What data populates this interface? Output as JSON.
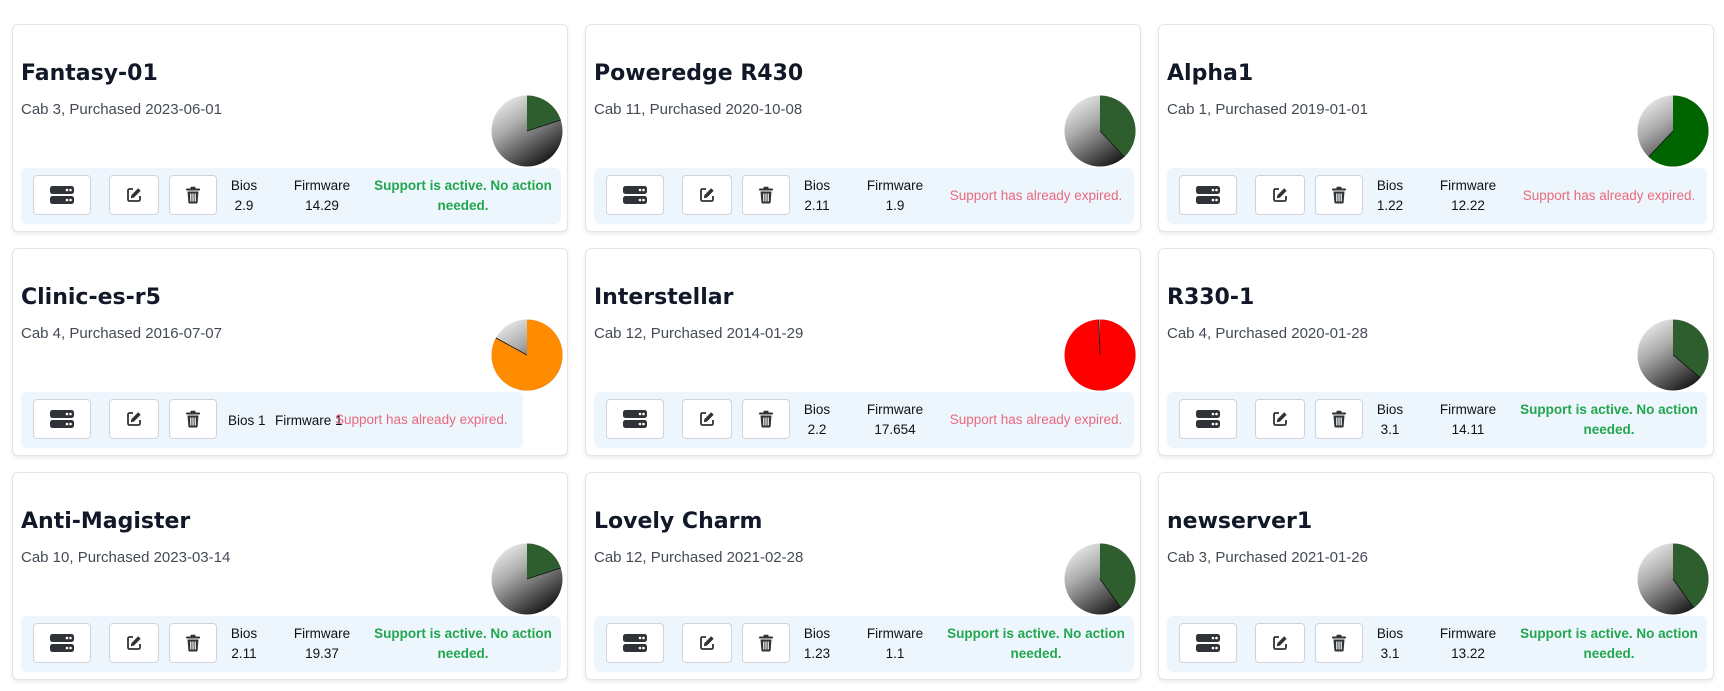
{
  "colors": {
    "active_text": "#22a64e",
    "expired_text": "#e8697d",
    "panel_bg": "#eef6fd",
    "pie_dark_green": "#2e5e2e",
    "pie_green": "#006400",
    "pie_orange": "#ff8c00",
    "pie_red": "#ff0000"
  },
  "icons": {
    "server": "server-icon",
    "edit": "edit-icon",
    "delete": "trash-icon"
  },
  "servers": [
    {
      "name": "Fantasy-01",
      "subtitle": "Cab 3, Purchased 2023-06-01",
      "bios_label": "Bios",
      "bios": "2.9",
      "firmware_label": "Firmware",
      "firmware": "14.29",
      "status": "Support is active. No action needed.",
      "status_type": "active",
      "pie": {
        "fraction": 0.2,
        "color": "#2e5e2e"
      }
    },
    {
      "name": "Poweredge R430",
      "subtitle": "Cab 11, Purchased 2020-10-08",
      "bios_label": "Bios",
      "bios": "2.11",
      "firmware_label": "Firmware",
      "firmware": "1.9",
      "status": "Support has already expired.",
      "status_type": "expired",
      "pie": {
        "fraction": 0.38,
        "color": "#2e5e2e"
      }
    },
    {
      "name": "Alpha1",
      "subtitle": "Cab 1, Purchased 2019-01-01",
      "bios_label": "Bios",
      "bios": "1.22",
      "firmware_label": "Firmware",
      "firmware": "12.22",
      "status": "Support has already expired.",
      "status_type": "expired",
      "pie": {
        "fraction": 0.62,
        "color": "#006400"
      }
    },
    {
      "name": "Clinic-es-r5",
      "subtitle": "Cab 4, Purchased 2016-07-07",
      "bios_label": "Bios",
      "bios": "1",
      "firmware_label": "Firmware",
      "firmware": "1",
      "status": "Support has already expired.",
      "status_type": "expired",
      "compact": true,
      "pie": {
        "fraction": 0.83,
        "color": "#ff8c00"
      }
    },
    {
      "name": "Interstellar",
      "subtitle": "Cab 12, Purchased 2014-01-29",
      "bios_label": "Bios",
      "bios": "2.2",
      "firmware_label": "Firmware",
      "firmware": "17.654",
      "status": "Support has already expired.",
      "status_type": "expired",
      "pie": {
        "fraction": 0.995,
        "color": "#ff0000"
      }
    },
    {
      "name": "R330-1",
      "subtitle": "Cab 4, Purchased 2020-01-28",
      "bios_label": "Bios",
      "bios": "3.1",
      "firmware_label": "Firmware",
      "firmware": "14.11",
      "status": "Support is active. No action needed.",
      "status_type": "active",
      "pie": {
        "fraction": 0.36,
        "color": "#2e5e2e"
      }
    },
    {
      "name": "Anti-Magister",
      "subtitle": "Cab 10, Purchased 2023-03-14",
      "bios_label": "Bios",
      "bios": "2.11",
      "firmware_label": "Firmware",
      "firmware": "19.37",
      "status": "Support is active. No action needed.",
      "status_type": "active",
      "pie": {
        "fraction": 0.2,
        "color": "#2e5e2e"
      }
    },
    {
      "name": "Lovely Charm",
      "subtitle": "Cab 12, Purchased 2021-02-28",
      "bios_label": "Bios",
      "bios": "1.23",
      "firmware_label": "Firmware",
      "firmware": "1.1",
      "status": "Support is active. No action needed.",
      "status_type": "active",
      "pie": {
        "fraction": 0.4,
        "color": "#2e5e2e"
      }
    },
    {
      "name": "newserver1",
      "subtitle": "Cab 3, Purchased 2021-01-26",
      "bios_label": "Bios",
      "bios": "3.1",
      "firmware_label": "Firmware",
      "firmware": "13.22",
      "status": "Support is active. No action needed.",
      "status_type": "active",
      "pie": {
        "fraction": 0.4,
        "color": "#2e5e2e"
      }
    }
  ]
}
